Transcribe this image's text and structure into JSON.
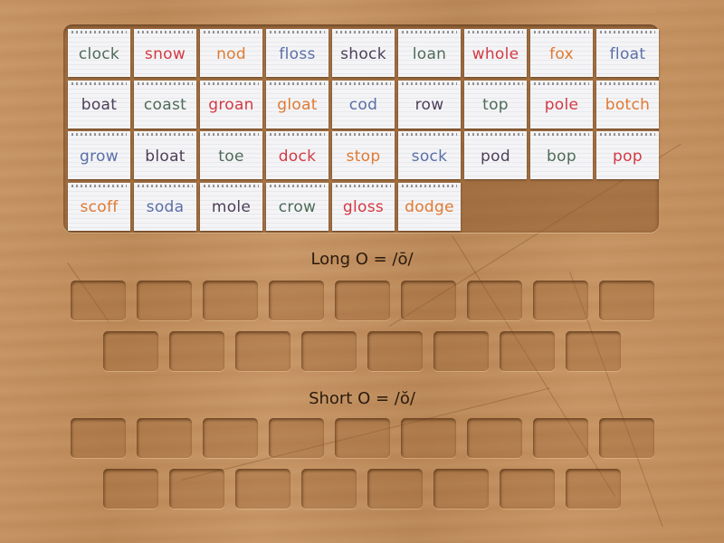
{
  "game": {
    "type": "group sort",
    "tray": {
      "tiles": [
        {
          "word": "clock",
          "color": "#4f6b58"
        },
        {
          "word": "snow",
          "color": "#d23a43"
        },
        {
          "word": "nod",
          "color": "#e07a32"
        },
        {
          "word": "floss",
          "color": "#5a6fa8"
        },
        {
          "word": "shock",
          "color": "#4d3f5a"
        },
        {
          "word": "loan",
          "color": "#4f6b58"
        },
        {
          "word": "whole",
          "color": "#d23a43"
        },
        {
          "word": "fox",
          "color": "#e07a32"
        },
        {
          "word": "float",
          "color": "#5a6fa8"
        },
        {
          "word": "boat",
          "color": "#4d3f5a"
        },
        {
          "word": "coast",
          "color": "#4f6b58"
        },
        {
          "word": "groan",
          "color": "#d23a43"
        },
        {
          "word": "gloat",
          "color": "#e07a32"
        },
        {
          "word": "cod",
          "color": "#5a6fa8"
        },
        {
          "word": "row",
          "color": "#4d3f5a"
        },
        {
          "word": "top",
          "color": "#4f6b58"
        },
        {
          "word": "pole",
          "color": "#d23a43"
        },
        {
          "word": "botch",
          "color": "#e07a32"
        },
        {
          "word": "grow",
          "color": "#5a6fa8"
        },
        {
          "word": "bloat",
          "color": "#4d3f5a"
        },
        {
          "word": "toe",
          "color": "#4f6b58"
        },
        {
          "word": "dock",
          "color": "#d23a43"
        },
        {
          "word": "stop",
          "color": "#e07a32"
        },
        {
          "word": "sock",
          "color": "#5a6fa8"
        },
        {
          "word": "pod",
          "color": "#4d3f5a"
        },
        {
          "word": "bop",
          "color": "#4f6b58"
        },
        {
          "word": "pop",
          "color": "#d23a43"
        },
        {
          "word": "scoff",
          "color": "#e07a32"
        },
        {
          "word": "soda",
          "color": "#5a6fa8"
        },
        {
          "word": "mole",
          "color": "#4d3f5a"
        },
        {
          "word": "crow",
          "color": "#4f6b58"
        },
        {
          "word": "gloss",
          "color": "#d23a43"
        },
        {
          "word": "dodge",
          "color": "#e07a32"
        }
      ]
    },
    "groups": [
      {
        "title": "Long O = /ō/",
        "slot_rows": [
          9,
          8
        ]
      },
      {
        "title": "Short O = /ŏ/",
        "slot_rows": [
          9,
          8
        ]
      }
    ]
  }
}
